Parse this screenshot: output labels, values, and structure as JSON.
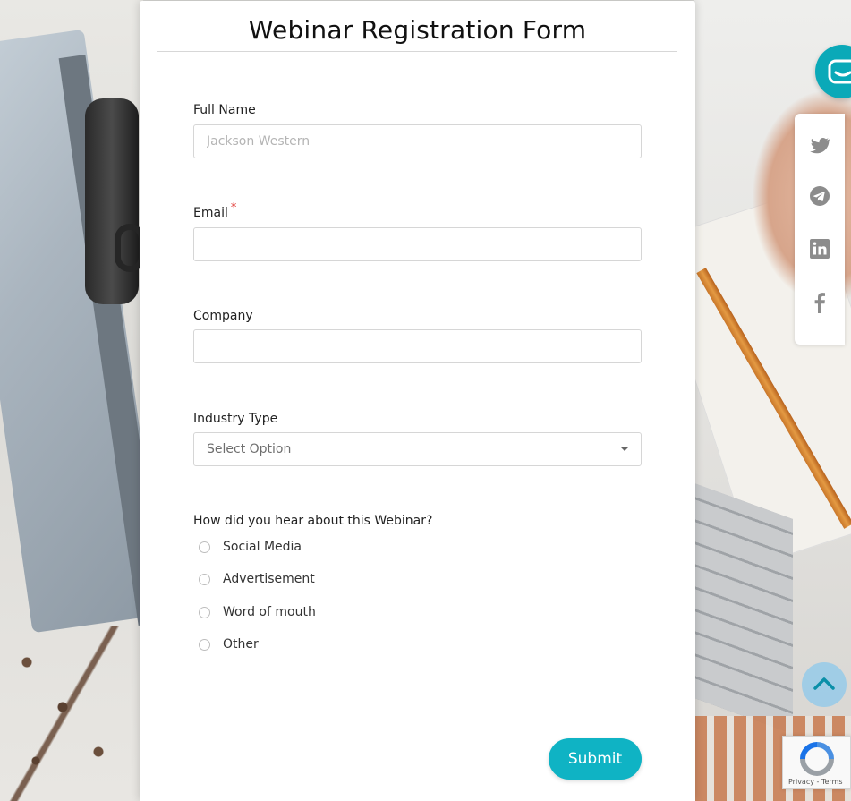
{
  "form": {
    "title": "Webinar Registration Form",
    "full_name": {
      "label": "Full Name",
      "placeholder": "Jackson Western",
      "value": ""
    },
    "email": {
      "label": "Email",
      "required_mark": "*",
      "value": ""
    },
    "company": {
      "label": "Company",
      "value": ""
    },
    "industry": {
      "label": "Industry Type",
      "selected": "Select Option"
    },
    "hear_about": {
      "label": "How did you hear about this Webinar?",
      "options": [
        "Social Media",
        "Advertisement",
        "Word of mouth",
        "Other"
      ]
    },
    "submit_label": "Submit"
  },
  "social": {
    "icons": [
      "twitter-icon",
      "telegram-icon",
      "linkedin-icon",
      "facebook-icon"
    ],
    "icon_color": "#8c8c8c"
  },
  "recaptcha": {
    "privacy": "Privacy",
    "separator": " - ",
    "terms": "Terms"
  },
  "colors": {
    "accent": "#0fb3c4",
    "required": "#e0322e",
    "chat": "#0aa9b8"
  }
}
